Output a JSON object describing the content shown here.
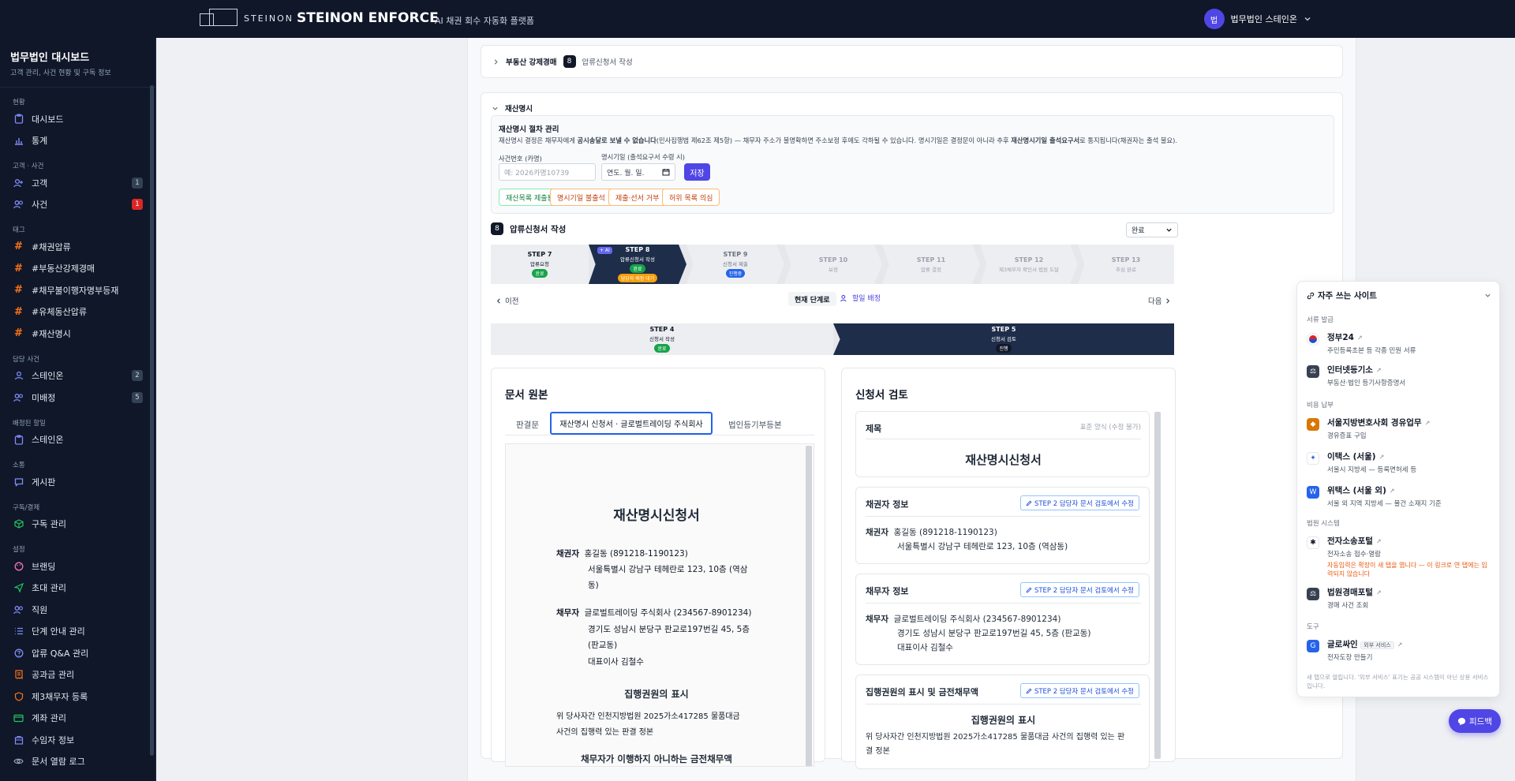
{
  "topbar": {
    "brand_word": "STEINON",
    "app_title": "STEINON ENFORCE",
    "app_subtitle": "AI 채권 회수 자동화 플랫폼",
    "avatar_initial": "법",
    "user_name": "법무법인 스테인온"
  },
  "sidebar": {
    "title": "법무법인 대시보드",
    "desc": "고객 관리, 사건 현황 및 구독 정보",
    "sections": {
      "status": "현황",
      "client_case": "고객 · 사건",
      "tags": "태그",
      "assigned": "담당 사건",
      "assigned_tasks": "배정된 할일",
      "comm": "소통",
      "billing": "구독/결제",
      "settings": "설정"
    },
    "items": {
      "dashboard": "대시보드",
      "stats": "통계",
      "clients": "고객",
      "clients_count": "1",
      "cases": "사건",
      "cases_count": "1",
      "tag1": "#채권압류",
      "tag2": "#부동산강제경매",
      "tag3": "#채무불이행자명부등재",
      "tag4": "#유체동산압류",
      "tag5": "#재산명시",
      "steinon": "스테인온",
      "steinon_count": "2",
      "unassigned": "미배정",
      "unassigned_count": "5",
      "task_steinon": "스테인온",
      "board": "게시판",
      "subscription": "구독 관리",
      "branding": "브랜딩",
      "invite": "초대 관리",
      "staff": "직원",
      "step_guide": "단계 안내 관리",
      "qa": "압류 Q&A 관리",
      "utility": "공과금 관리",
      "third_party": "제3채무자 등록",
      "account": "계좌 관리",
      "beneficiary": "수임자 정보",
      "doc_log": "문서 열람 로그"
    }
  },
  "main": {
    "collapsed": {
      "label": "부동산 강제경매",
      "step": "8",
      "title": "압류신청서 작성"
    },
    "asset": {
      "header": "재산명시",
      "proc_title": "재산명시 절차 관리",
      "proc_desc_a": "재산명시 결정은 채무자에게 ",
      "proc_desc_b": "공시송달로 보낼 수 없습니다",
      "proc_desc_c": "(민사집행법 제62조 제5항) — 채무자 주소가 불명확하면 주소보정 후에도 각하될 수 있습니다. 명시기일은 결정문이 아니라 추후 ",
      "proc_desc_d": "재산명시기일 출석요구서",
      "proc_desc_e": "로 통지됩니다(채권자는 출석 불요).",
      "case_label": "사건번호 (카명)",
      "case_placeholder": "예: 2026카명10739",
      "date_label": "명시기일 (출석요구서 수령 시)",
      "date_placeholder": "연도. 월. 일.",
      "save": "저장",
      "chips": [
        "재산목록 제출됨",
        "명시기일 불출석",
        "제출·선서 거부",
        "허위 목록 의심"
      ]
    },
    "section": {
      "step": "8",
      "title": "압류신청서 작성",
      "status": "완료"
    },
    "stepper": [
      {
        "title": "STEP 7",
        "sub": "압류요청",
        "pill": "완료"
      },
      {
        "title": "STEP 8",
        "sub": "압류신청서 작성",
        "pill": "완료",
        "pill2": "담당자 배정 대기",
        "badge": "+ AI"
      },
      {
        "title": "STEP 9",
        "sub": "신청서 제출",
        "pill": "진행중"
      },
      {
        "title": "STEP 10",
        "sub": "보정"
      },
      {
        "title": "STEP 11",
        "sub": "압류 결정"
      },
      {
        "title": "STEP 12",
        "sub": "제3채무자 확인서 법원 도달"
      },
      {
        "title": "STEP 13",
        "sub": "추심 완료"
      }
    ],
    "nav": {
      "prev": "이전",
      "current": "현재 단계로",
      "assign": "할일 배정",
      "next": "다음"
    },
    "substepper": [
      {
        "title": "STEP 4",
        "sub": "신청서 작성",
        "pill": "완료"
      },
      {
        "title": "STEP 5",
        "sub": "신청서 검토",
        "pill": "진행"
      }
    ],
    "left_card": {
      "title": "문서 원본",
      "tabs": [
        "판결문",
        "재산명시 신청서 · 글로벌트레이딩 주식회사",
        "법인등기부등본"
      ],
      "doc": {
        "title": "재산명시신청서",
        "creditor_label": "채권자",
        "creditor_line1": "홍길동 (891218-1190123)",
        "creditor_line2": "서울특별시 강남구 테헤란로 123, 10층 (역삼",
        "creditor_line3": "동)",
        "debtor_label": "채무자",
        "debtor_line1": "글로벌트레이딩 주식회사 (234567-8901234)",
        "debtor_line2": "경기도 성남시 분당구 판교로197번길 45, 5층",
        "debtor_line3": "(판교동)",
        "debtor_line4": "대표이사 김철수",
        "exec_title": "집행권원의 표시",
        "exec_line1": "위 당사자간 인천지방법원 2025가소417285 물품대금",
        "exec_line2": "사건의 집행력 있는 판결 정본",
        "unpaid_title": "채무자가 이행하지 아니하는 금전채무액"
      }
    },
    "right_card": {
      "title": "신청서 검토",
      "subject_label": "제목",
      "subject_note": "표준 양식 (수정 불가)",
      "subject_value": "재산명시신청서",
      "creditor_section": "채권자 정보",
      "debtor_section": "채무자 정보",
      "exec_section": "집행권원의 표시 및 금전채무액",
      "edit_btn": "STEP 2 담당자 문서 검토에서 수정",
      "creditor_label": "채권자",
      "creditor_line1": "홍길동 (891218-1190123)",
      "creditor_line2": "서울특별시 강남구 테헤란로 123, 10층 (역삼동)",
      "debtor_label": "채무자",
      "debtor_line1": "글로벌트레이딩 주식회사 (234567-8901234)",
      "debtor_line2": "경기도 성남시 분당구 판교로197번길 45, 5층 (판교동)",
      "debtor_line3": "대표이사 김철수",
      "exec_title": "집행권원의 표시",
      "exec_line1": "위 당사자간 인천지방법원 2025가소417285 물품대금 사건의 집행력 있는 판",
      "exec_line2": "결 정본"
    }
  },
  "sites_panel": {
    "title": "자주 쓰는 사이트",
    "sec_docs": "서류 발급",
    "sec_fees": "비용 납부",
    "sec_court": "법원 시스템",
    "sec_tools": "도구",
    "gov24": "정부24",
    "gov24_desc": "주민등록초본 등 각종 민원 서류",
    "iros": "인터넷등기소",
    "iros_desc": "부동산·법인 등기사항증명서",
    "bar": "서울지방변호사회 경유업무",
    "bar_desc": "경유증표 구입",
    "etax_seoul": "이택스 (서울)",
    "etax_seoul_desc": "서울시 지방세 — 등록면허세 등",
    "wetax": "위택스 (서울 외)",
    "wetax_desc": "서울 외 지역 지방세 — 물건 소재지 기준",
    "ecourt": "전자소송포털",
    "ecourt_desc": "전자소송 접수·열람",
    "ecourt_warn": "자동입력은 확장이 새 탭을 엽니다 — 이 링크로 연 탭에는 입력되지 않습니다",
    "auction": "법원경매포털",
    "auction_desc": "경매 사건 조회",
    "glosign": "글로싸인",
    "glosign_tag": "외부 서비스",
    "glosign_desc": "전자도장 만들기",
    "footer": "새 탭으로 열립니다. '외부 서비스' 표기는 공공 시스템이 아닌 상용 서비스입니다."
  },
  "feedback": "피드백",
  "colors": {
    "nav_bg": "#0f1729",
    "accent": "#4f46e5",
    "active_step": "#1e2d4a",
    "success": "#16a34a",
    "danger": "#dc2626"
  }
}
